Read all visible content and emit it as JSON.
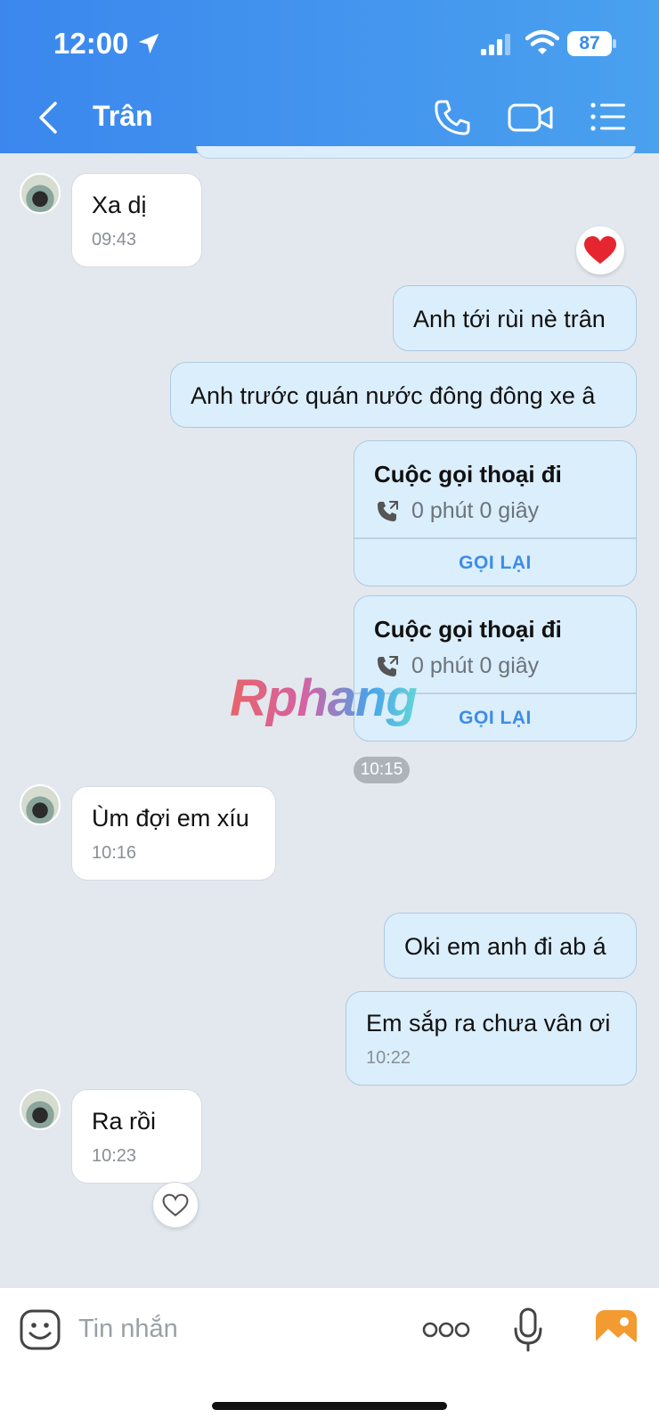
{
  "status_bar": {
    "time": "12:00",
    "battery": "87"
  },
  "header": {
    "title": "Trân"
  },
  "messages": {
    "m1": {
      "text": "Xa dị",
      "time": "09:43"
    },
    "m2": {
      "text": "Anh tới rùi nè trân"
    },
    "m3": {
      "text": "Anh trước quán nước đông đông xe â"
    },
    "call1": {
      "title": "Cuộc gọi thoại đi",
      "duration": "0 phút 0 giây",
      "action": "GỌI LẠI"
    },
    "call2": {
      "title": "Cuộc gọi thoại đi",
      "duration": "0 phút 0 giây",
      "action": "GỌI LẠI"
    },
    "time_divider": "10:15",
    "m4": {
      "text": "Ùm đợi em xíu",
      "time": "10:16"
    },
    "m5": {
      "text": "Oki em anh đi ab á"
    },
    "m6": {
      "text": "Em sắp ra chưa vân ơi",
      "time": "10:22"
    },
    "m7": {
      "text": "Ra rồi",
      "time": "10:23"
    }
  },
  "watermark": "Rphang",
  "composer": {
    "placeholder": "Tin nhắn"
  },
  "colors": {
    "header_gradient_start": "#3b87ee",
    "header_gradient_end": "#4aa1ee",
    "chat_background": "#e3e8ef",
    "outgoing_bubble": "#dbeefc",
    "incoming_bubble": "#ffffff",
    "accent": "#3d8ce8"
  },
  "icons": [
    "location-arrow-icon",
    "signal-icon",
    "wifi-icon",
    "battery-icon",
    "back-chevron-icon",
    "phone-icon",
    "video-camera-icon",
    "list-menu-icon",
    "heart-icon",
    "phone-outgoing-icon",
    "heart-outline-icon",
    "sticker-icon",
    "more-dots-icon",
    "microphone-icon",
    "photo-icon"
  ]
}
